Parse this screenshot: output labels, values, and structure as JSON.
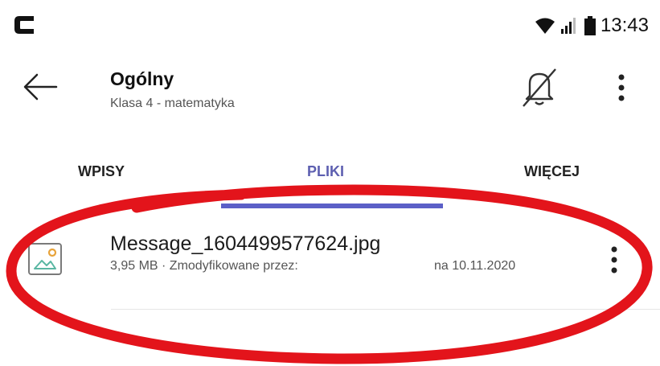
{
  "status_bar": {
    "time": "13:43",
    "logo_letter_icon": "c-logo-icon",
    "wifi_icon": "wifi-icon",
    "signal_icon": "signal-icon",
    "battery_icon": "battery-icon"
  },
  "header": {
    "title": "Ogólny",
    "subtitle": "Klasa 4 - matematyka",
    "back_icon": "arrow-left-icon",
    "bell_icon": "bell-off-icon",
    "more_icon": "more-vertical-icon"
  },
  "tabs": [
    {
      "label": "WPISY",
      "active": false
    },
    {
      "label": "PLIKI",
      "active": true
    },
    {
      "label": "WIĘCEJ",
      "active": false
    }
  ],
  "files": [
    {
      "name": "Message_1604499577624.jpg",
      "meta": "3,95 MB · Zmodyfikowane przez:",
      "date": "na 10.11.2020",
      "icon": "image-file-icon",
      "more_icon": "more-vertical-icon"
    }
  ],
  "colors": {
    "accent": "#5b5fc7",
    "annotation": "#e3141b",
    "text_primary": "#1b1b1b",
    "text_secondary": "#555555"
  }
}
